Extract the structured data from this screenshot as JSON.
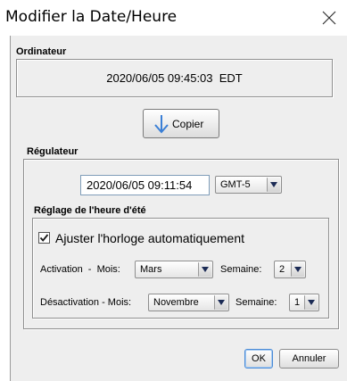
{
  "dialog": {
    "title": "Modifier la Date/Heure",
    "close_icon": "close-icon"
  },
  "ordinateur": {
    "label": "Ordinateur",
    "time": "2020/06/05 09:45:03  EDT"
  },
  "copy_button": {
    "label": "Copier",
    "icon": "down-arrow-icon",
    "icon_color": "#3a7fd6"
  },
  "regulateur": {
    "label": "Régulateur",
    "date_value": "2020/06/05 09:11:54",
    "timezone": "GMT-5"
  },
  "dst": {
    "label": "Réglage de l'heure d'été",
    "auto_checkbox_label": "Ajuster l'horloge automatiquement",
    "auto_checked": true,
    "activation_label": "Activation  -  Mois:",
    "activation_month": "Mars",
    "activation_week_label": "Semaine:",
    "activation_week": "2",
    "deactivation_label": "Désactivation - Mois:",
    "deactivation_month": "Novembre",
    "deactivation_week_label": "Semaine:",
    "deactivation_week": "1"
  },
  "buttons": {
    "ok": "OK",
    "cancel": "Annuler"
  }
}
